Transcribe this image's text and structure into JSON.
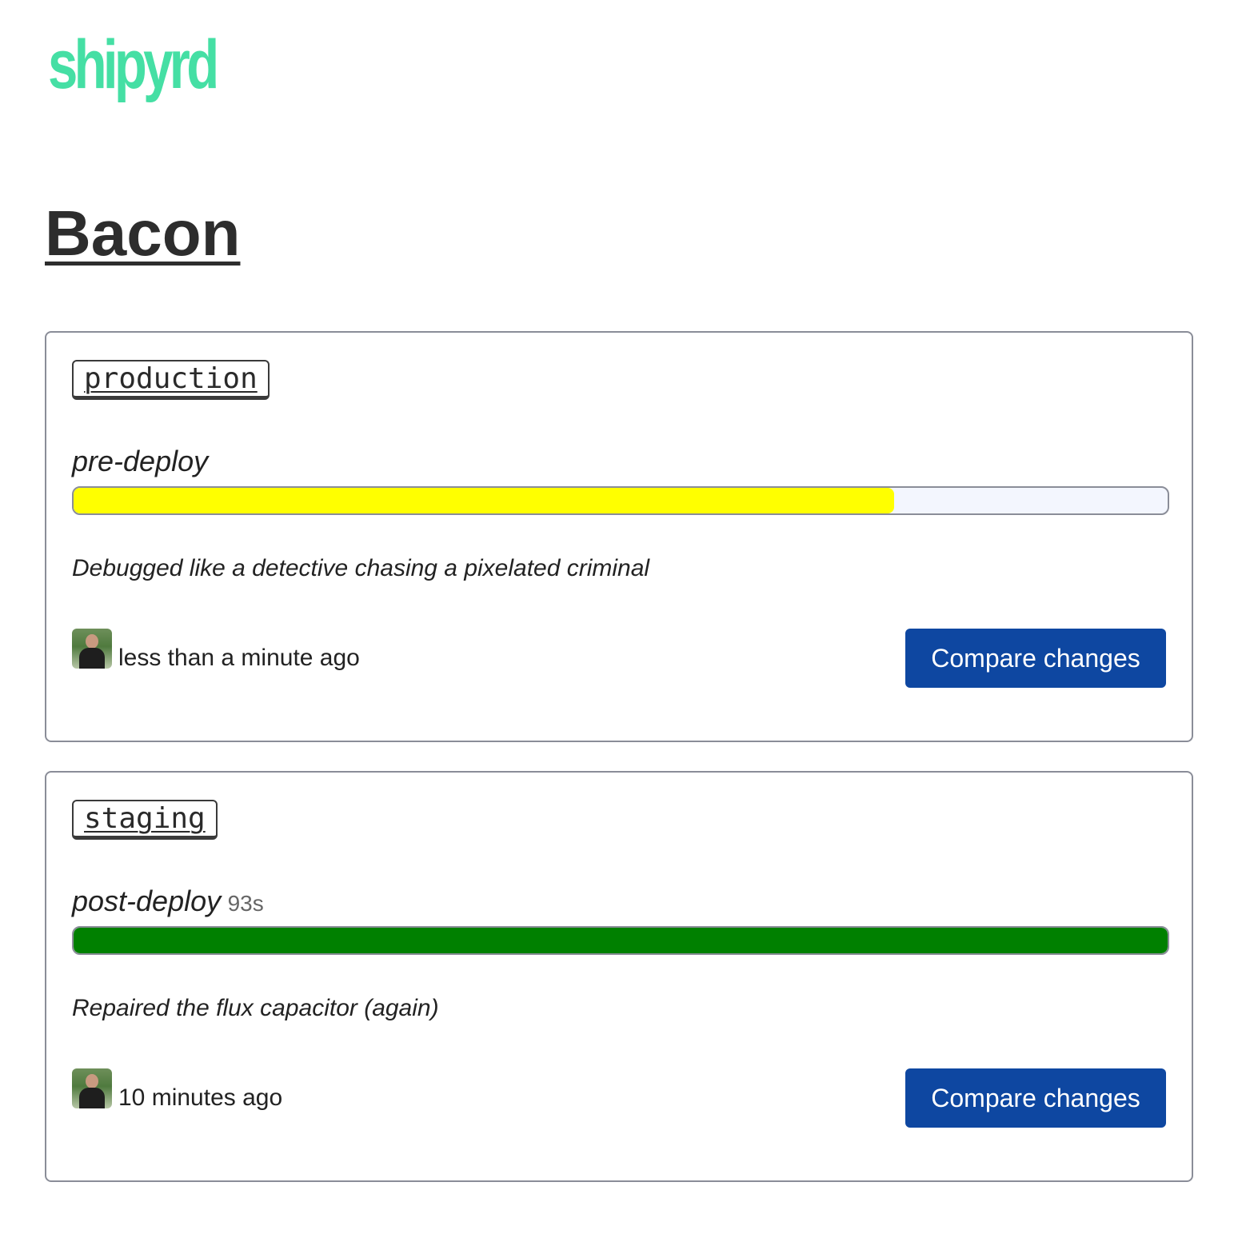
{
  "app": {
    "logo_text": "shipyrd",
    "logo_color": "#45dfa4"
  },
  "page": {
    "title": "Bacon"
  },
  "deploys": [
    {
      "environment": "production",
      "stage": "pre-deploy",
      "duration": "",
      "progress_percent": 75,
      "progress_color": "#ffff00",
      "message": "Debugged like a detective chasing a pixelated criminal",
      "avatar_icon": "user-avatar",
      "time": "less than a minute ago",
      "compare_label": "Compare changes"
    },
    {
      "environment": "staging",
      "stage": "post-deploy",
      "duration": "93s",
      "progress_percent": 100,
      "progress_color": "#008000",
      "message": "Repaired the flux capacitor (again)",
      "avatar_icon": "user-avatar",
      "time": "10 minutes ago",
      "compare_label": "Compare changes"
    }
  ],
  "colors": {
    "button_bg": "#0e47a1",
    "progress_track": "#f3f6fe",
    "border": "#8a8d98"
  }
}
